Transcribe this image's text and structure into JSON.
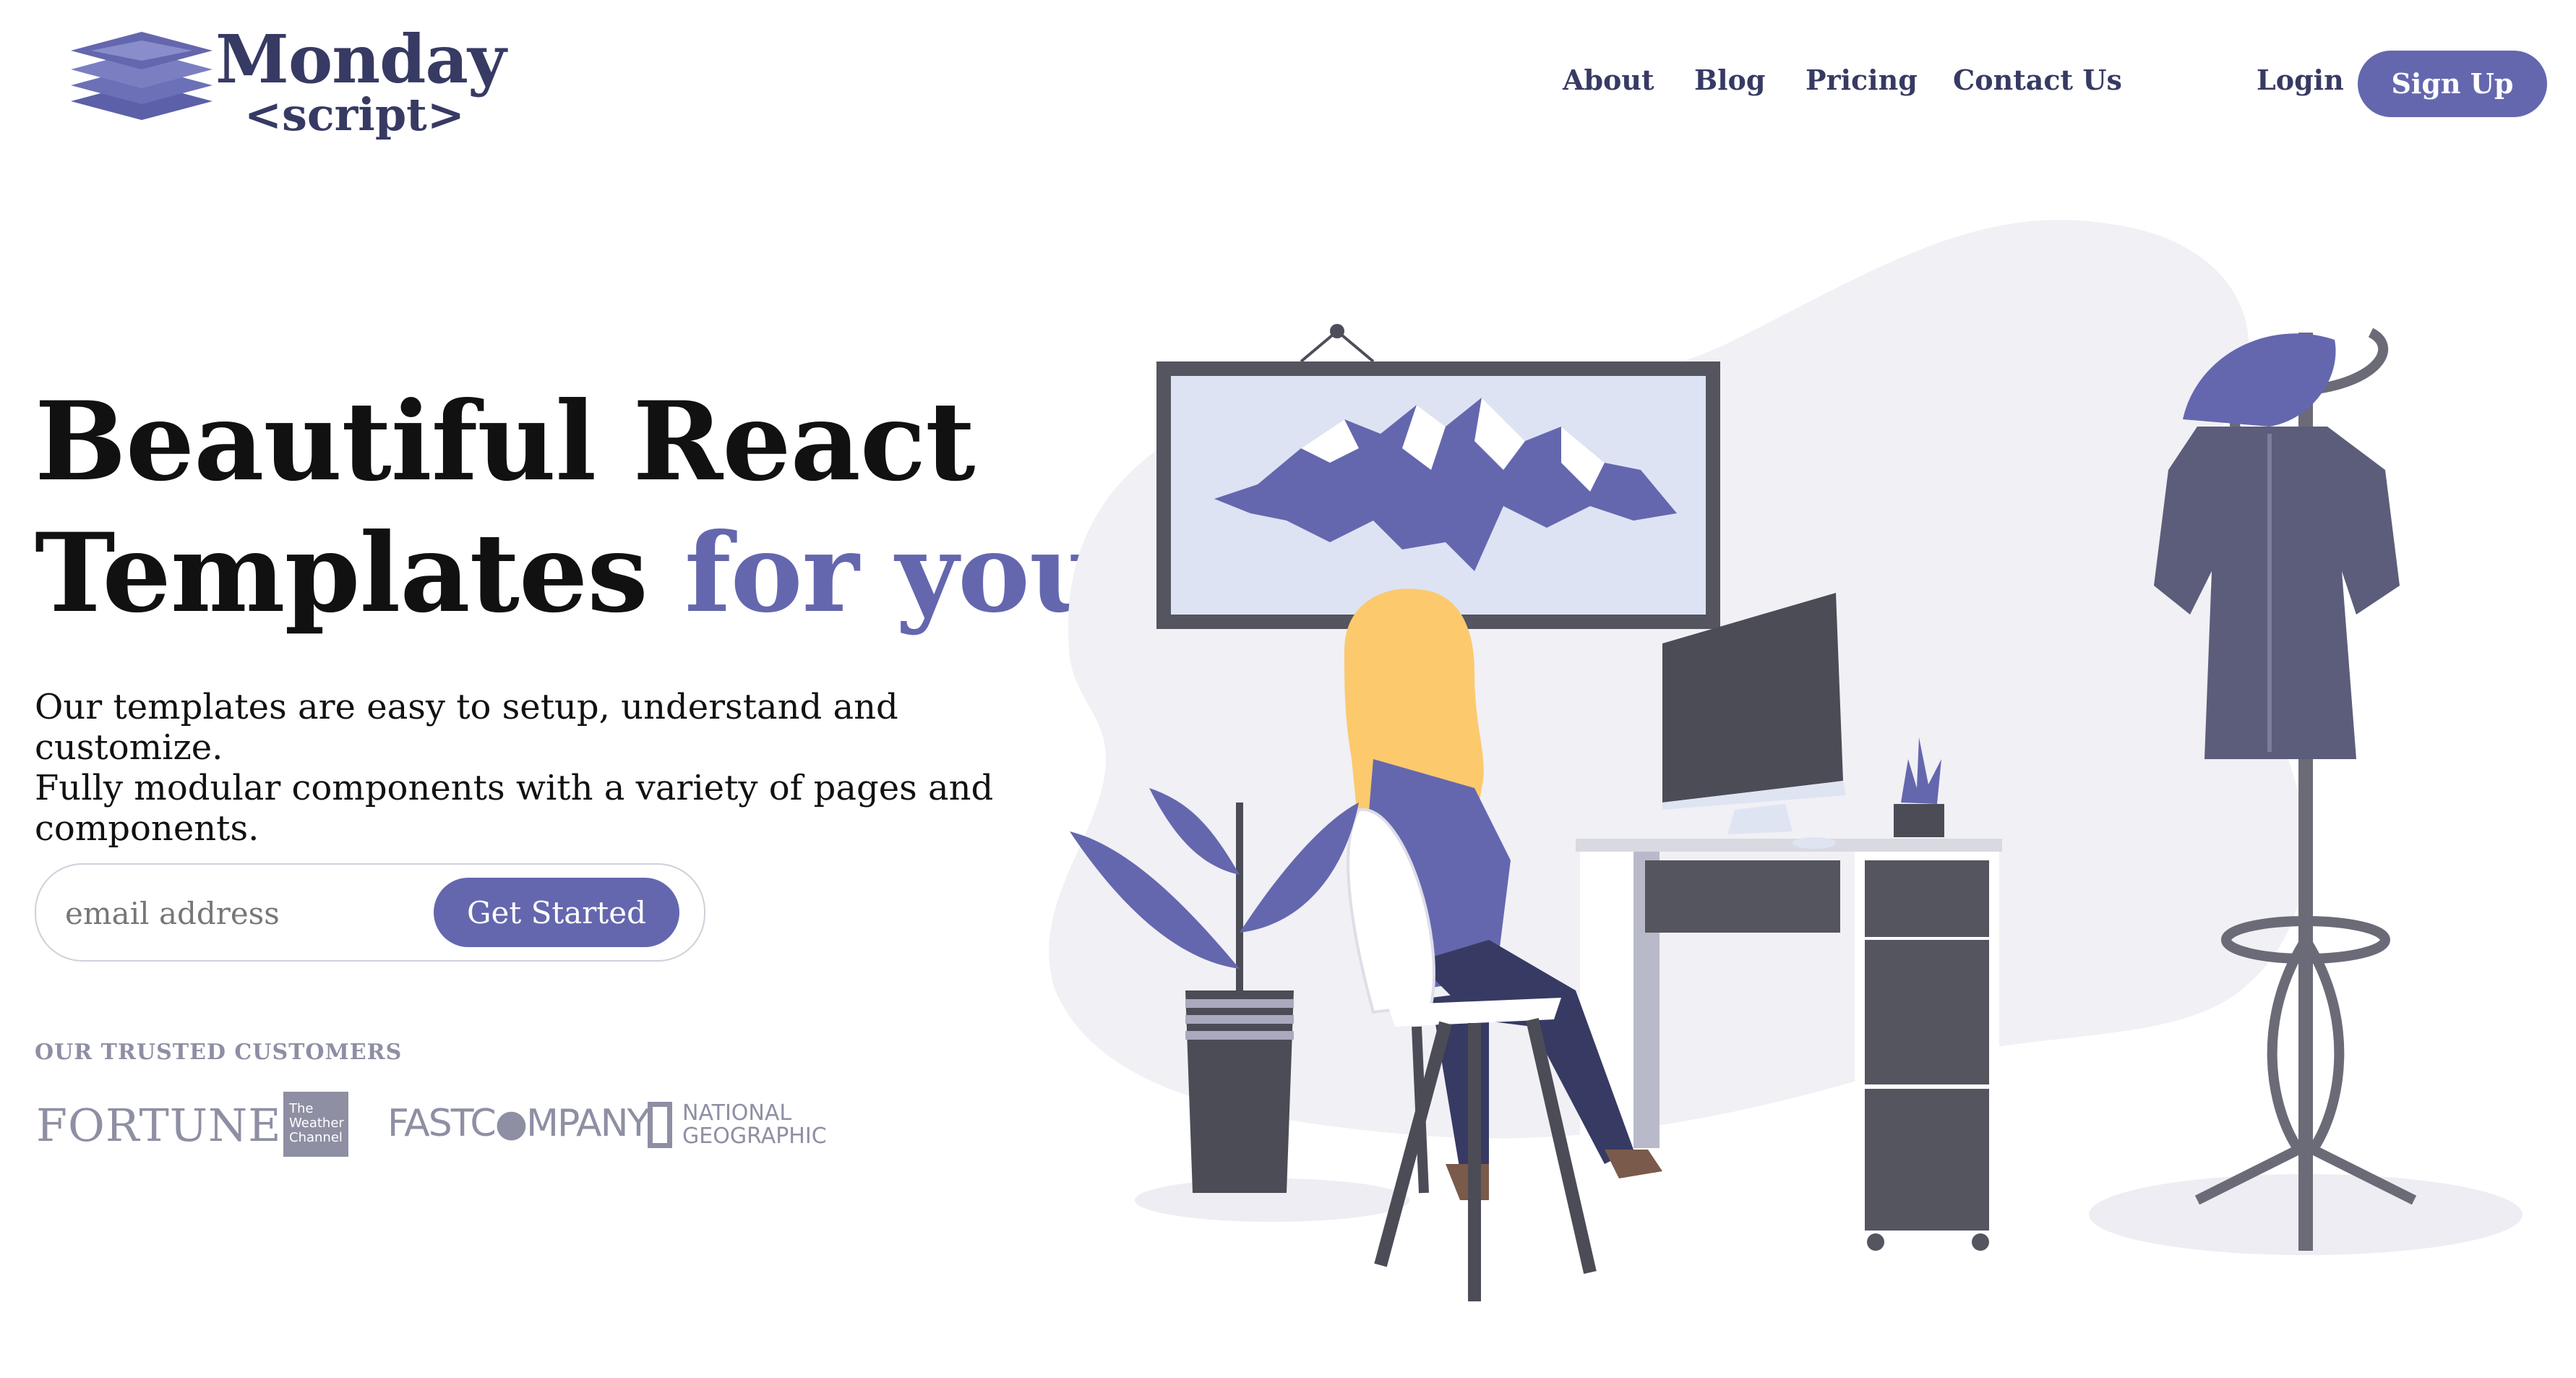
{
  "brand": {
    "name_line1": "Monday",
    "name_line2": "<script>",
    "logo_icon": "stacked-layers-icon",
    "color": "#373a63"
  },
  "nav": {
    "items": [
      {
        "label": "About"
      },
      {
        "label": "Blog"
      },
      {
        "label": "Pricing"
      },
      {
        "label": "Contact Us"
      }
    ],
    "login": "Login",
    "signup": "Sign Up"
  },
  "hero": {
    "title_line1": "Beautiful React",
    "title_line2_plain": "Templates ",
    "title_line2_accent": "for you.",
    "subtitle_lines": [
      "Our templates are easy to setup, understand and customize.",
      "Fully modular components with a variety of pages and",
      "components."
    ],
    "email_placeholder": "email address",
    "cta": "Get Started"
  },
  "customers": {
    "heading": "OUR TRUSTED CUSTOMERS",
    "logos": [
      {
        "name": "FORTUNE"
      },
      {
        "name": "The Weather Channel",
        "lines": [
          "The",
          "Weather",
          "Channel"
        ]
      },
      {
        "name": "FASTCOMPANY",
        "display": "FASTC●MPANY"
      },
      {
        "name": "NATIONAL GEOGRAPHIC",
        "lines": [
          "NATIONAL",
          "GEOGRAPHIC"
        ]
      }
    ]
  },
  "colors": {
    "accent": "#6467ae",
    "navy": "#373a63",
    "muted": "#8e8fa3",
    "illustration_bg": "#f0f0f5"
  }
}
